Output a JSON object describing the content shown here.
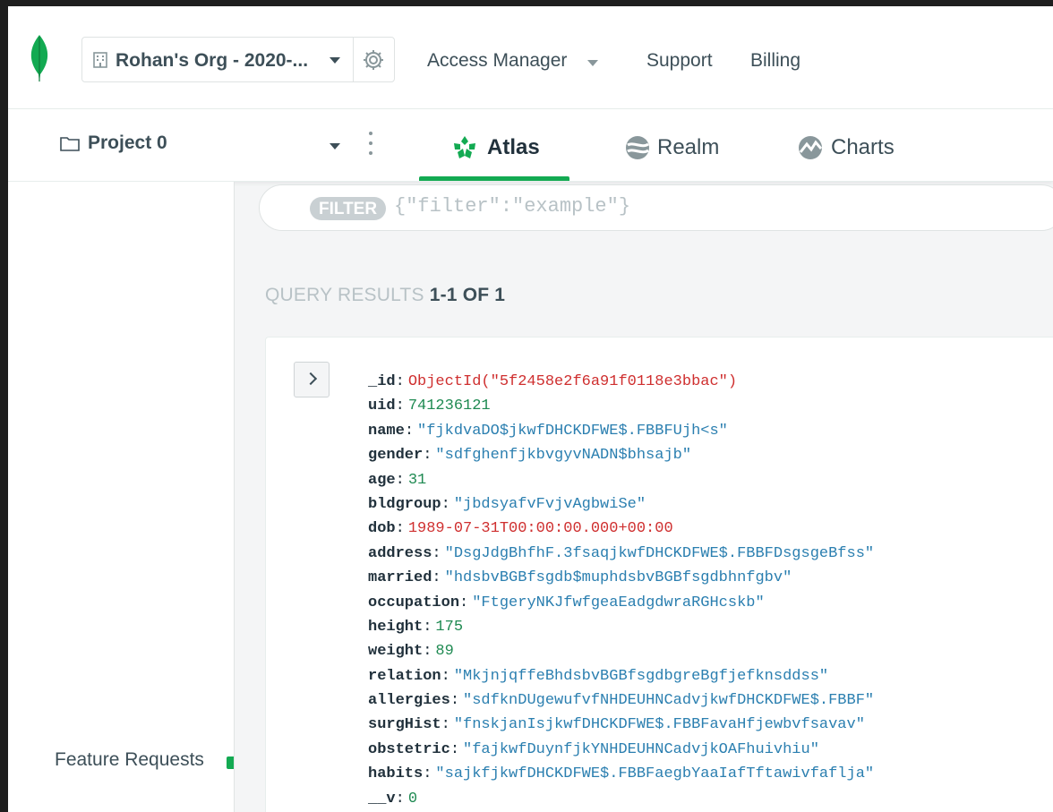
{
  "topbar": {
    "org_name": "Rohan's Org - 2020-...",
    "nav": {
      "access_manager": "Access Manager",
      "support": "Support",
      "billing": "Billing"
    }
  },
  "projectbar": {
    "project_name": "Project 0",
    "tabs": [
      {
        "label": "Atlas",
        "active": true
      },
      {
        "label": "Realm",
        "active": false
      },
      {
        "label": "Charts",
        "active": false
      }
    ]
  },
  "sidebar": {
    "feature_requests": "Feature Requests"
  },
  "filter": {
    "badge": "FILTER",
    "placeholder": "{\"filter\":\"example\"}"
  },
  "results": {
    "label": "QUERY RESULTS",
    "range": "1-1 OF 1"
  },
  "document": {
    "fields": [
      {
        "key": "_id",
        "value": "ObjectId(\"5f2458e2f6a91f0118e3bbac\")",
        "type": "oid"
      },
      {
        "key": "uid",
        "value": "741236121",
        "type": "number"
      },
      {
        "key": "name",
        "value": "\"fjkdvaDO$jkwfDHCKDFWE$.FBBFUjh<s\"",
        "type": "string"
      },
      {
        "key": "gender",
        "value": "\"sdfghenfjkbvgyvNADN$bhsajb\"",
        "type": "string"
      },
      {
        "key": "age",
        "value": "31",
        "type": "number"
      },
      {
        "key": "bldgroup",
        "value": "\"jbdsyafvFvjvAgbwiSe\"",
        "type": "string"
      },
      {
        "key": "dob",
        "value": "1989-07-31T00:00:00.000+00:00",
        "type": "date"
      },
      {
        "key": "address",
        "value": "\"DsgJdgBhfhF.3fsaqjkwfDHCKDFWE$.FBBFDsgsgeBfss\"",
        "type": "string"
      },
      {
        "key": "married",
        "value": "\"hdsbvBGBfsgdb$muphdsbvBGBfsgdbhnfgbv\"",
        "type": "string"
      },
      {
        "key": "occupation",
        "value": "\"FtgeryNKJfwfgeaEadgdwraRGHcskb\"",
        "type": "string"
      },
      {
        "key": "height",
        "value": "175",
        "type": "number"
      },
      {
        "key": "weight",
        "value": "89",
        "type": "number"
      },
      {
        "key": "relation",
        "value": "\"MkjnjqffeBhdsbvBGBfsgdbgreBgfjefknsddss\"",
        "type": "string"
      },
      {
        "key": "allergies",
        "value": "\"sdfknDUgewufvfNHDEUHNCadvjkwfDHCKDFWE$.FBBF\"",
        "type": "string"
      },
      {
        "key": "surgHist",
        "value": "\"fnskjanIsjkwfDHCKDFWE$.FBBFavaHfjewbvfsavav\"",
        "type": "string"
      },
      {
        "key": "obstetric",
        "value": "\"fajkwfDuynfjkYNHDEUHNCadvjkOAFhuivhiu\"",
        "type": "string"
      },
      {
        "key": "habits",
        "value": "\"sajkfjkwfDHCKDFWE$.FBBFaegbYaaIafTftawivfaflja\"",
        "type": "string"
      },
      {
        "key": "__v",
        "value": "0",
        "type": "number"
      }
    ]
  },
  "colors": {
    "brand_green": "#13aa52",
    "text": "#3d4f58",
    "string": "#2b7fb0",
    "oid": "#cf2f2f"
  },
  "icons": [
    "mongodb-leaf-icon",
    "building-icon",
    "gear-icon",
    "folder-icon",
    "kebab-icon",
    "atlas-icon",
    "realm-icon",
    "charts-icon"
  ]
}
